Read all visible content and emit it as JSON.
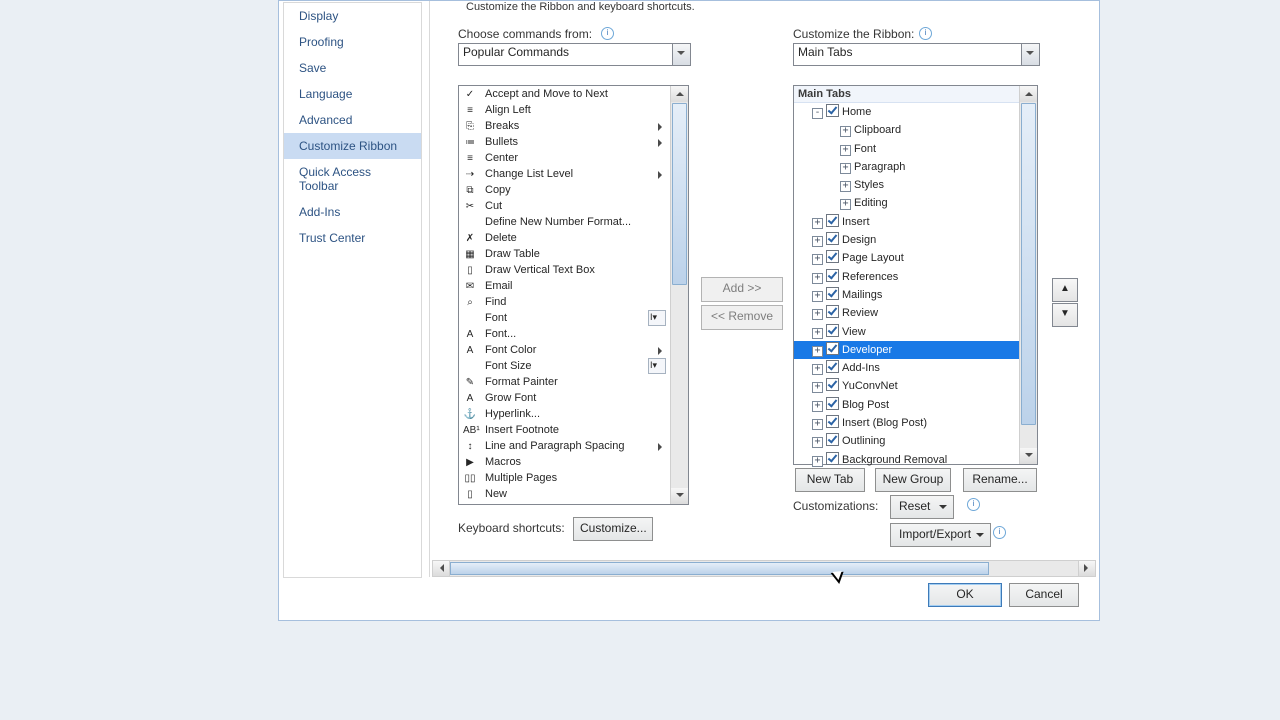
{
  "sidenav": {
    "items": [
      "Display",
      "Proofing",
      "Save",
      "Language",
      "Advanced",
      "Customize Ribbon",
      "Quick Access Toolbar",
      "Add-Ins",
      "Trust Center"
    ],
    "selected": 5
  },
  "header": "Customize the Ribbon and keyboard shortcuts.",
  "choose_label": "Choose commands from:",
  "choose_value": "Popular Commands",
  "ribbon_label": "Customize the Ribbon:",
  "ribbon_value": "Main Tabs",
  "commands": [
    {
      "t": "Accept and Move to Next",
      "ic": "✓"
    },
    {
      "t": "Align Left",
      "ic": "≡"
    },
    {
      "t": "Breaks",
      "ic": "⎘",
      "fly": true
    },
    {
      "t": "Bullets",
      "ic": "≔",
      "fly": true
    },
    {
      "t": "Center",
      "ic": "≡"
    },
    {
      "t": "Change List Level",
      "ic": "⇢",
      "fly": true
    },
    {
      "t": "Copy",
      "ic": "⧉"
    },
    {
      "t": "Cut",
      "ic": "✂"
    },
    {
      "t": "Define New Number Format...",
      "ic": " "
    },
    {
      "t": "Delete",
      "ic": "✗"
    },
    {
      "t": "Draw Table",
      "ic": "▦"
    },
    {
      "t": "Draw Vertical Text Box",
      "ic": "▯"
    },
    {
      "t": "Email",
      "ic": "✉"
    },
    {
      "t": "Find",
      "ic": "⌕"
    },
    {
      "t": "Font",
      "ic": " ",
      "sel": "I▾"
    },
    {
      "t": "Font...",
      "ic": "A"
    },
    {
      "t": "Font Color",
      "ic": "A",
      "fly": true
    },
    {
      "t": "Font Size",
      "ic": " ",
      "sel": "I▾"
    },
    {
      "t": "Format Painter",
      "ic": "✎"
    },
    {
      "t": "Grow Font",
      "ic": "A"
    },
    {
      "t": "Hyperlink...",
      "ic": "⚓"
    },
    {
      "t": "Insert Footnote",
      "ic": "AB¹"
    },
    {
      "t": "Line and Paragraph Spacing",
      "ic": "↕",
      "fly": true
    },
    {
      "t": "Macros",
      "ic": "▶"
    },
    {
      "t": "Multiple Pages",
      "ic": "▯▯"
    },
    {
      "t": "New",
      "ic": "▯"
    }
  ],
  "tree_header": "Main Tabs",
  "tree": [
    {
      "lvl": 1,
      "exp": "-",
      "cb": true,
      "t": "Home"
    },
    {
      "lvl": 2,
      "exp": "+",
      "t": "Clipboard"
    },
    {
      "lvl": 2,
      "exp": "+",
      "t": "Font"
    },
    {
      "lvl": 2,
      "exp": "+",
      "t": "Paragraph"
    },
    {
      "lvl": 2,
      "exp": "+",
      "t": "Styles"
    },
    {
      "lvl": 2,
      "exp": "+",
      "t": "Editing"
    },
    {
      "lvl": 1,
      "exp": "+",
      "cb": true,
      "t": "Insert"
    },
    {
      "lvl": 1,
      "exp": "+",
      "cb": true,
      "t": "Design"
    },
    {
      "lvl": 1,
      "exp": "+",
      "cb": true,
      "t": "Page Layout"
    },
    {
      "lvl": 1,
      "exp": "+",
      "cb": true,
      "t": "References"
    },
    {
      "lvl": 1,
      "exp": "+",
      "cb": true,
      "t": "Mailings"
    },
    {
      "lvl": 1,
      "exp": "+",
      "cb": true,
      "t": "Review"
    },
    {
      "lvl": 1,
      "exp": "+",
      "cb": true,
      "t": "View"
    },
    {
      "lvl": 1,
      "exp": "+",
      "cb": true,
      "t": "Developer",
      "sel": true
    },
    {
      "lvl": 1,
      "exp": "+",
      "cb": true,
      "t": "Add-Ins"
    },
    {
      "lvl": 1,
      "exp": "+",
      "cb": true,
      "t": "YuConvNet"
    },
    {
      "lvl": 1,
      "exp": "+",
      "cb": true,
      "t": "Blog Post"
    },
    {
      "lvl": 1,
      "exp": "+",
      "cb": true,
      "t": "Insert (Blog Post)"
    },
    {
      "lvl": 1,
      "exp": "+",
      "cb": true,
      "t": "Outlining"
    },
    {
      "lvl": 1,
      "exp": "+",
      "cb": true,
      "t": "Background Removal"
    }
  ],
  "add_btn": "Add >>",
  "remove_btn": "<< Remove",
  "btn_newtab": "New Tab",
  "btn_newgroup": "New Group",
  "btn_rename": "Rename...",
  "cust_label": "Customizations:",
  "btn_reset": "Reset",
  "btn_import": "Import/Export",
  "kbd_label": "Keyboard shortcuts:",
  "btn_customize": "Customize...",
  "btn_ok": "OK",
  "btn_cancel": "Cancel"
}
